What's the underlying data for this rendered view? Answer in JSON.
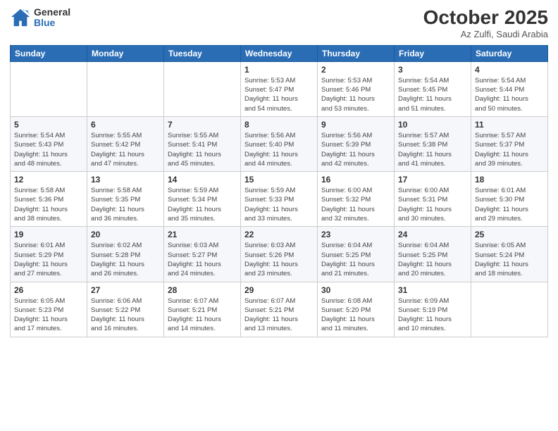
{
  "header": {
    "logo_general": "General",
    "logo_blue": "Blue",
    "month_title": "October 2025",
    "subtitle": "Az Zulfi, Saudi Arabia"
  },
  "weekdays": [
    "Sunday",
    "Monday",
    "Tuesday",
    "Wednesday",
    "Thursday",
    "Friday",
    "Saturday"
  ],
  "weeks": [
    [
      {
        "day": "",
        "detail": ""
      },
      {
        "day": "",
        "detail": ""
      },
      {
        "day": "",
        "detail": ""
      },
      {
        "day": "1",
        "detail": "Sunrise: 5:53 AM\nSunset: 5:47 PM\nDaylight: 11 hours\nand 54 minutes."
      },
      {
        "day": "2",
        "detail": "Sunrise: 5:53 AM\nSunset: 5:46 PM\nDaylight: 11 hours\nand 53 minutes."
      },
      {
        "day": "3",
        "detail": "Sunrise: 5:54 AM\nSunset: 5:45 PM\nDaylight: 11 hours\nand 51 minutes."
      },
      {
        "day": "4",
        "detail": "Sunrise: 5:54 AM\nSunset: 5:44 PM\nDaylight: 11 hours\nand 50 minutes."
      }
    ],
    [
      {
        "day": "5",
        "detail": "Sunrise: 5:54 AM\nSunset: 5:43 PM\nDaylight: 11 hours\nand 48 minutes."
      },
      {
        "day": "6",
        "detail": "Sunrise: 5:55 AM\nSunset: 5:42 PM\nDaylight: 11 hours\nand 47 minutes."
      },
      {
        "day": "7",
        "detail": "Sunrise: 5:55 AM\nSunset: 5:41 PM\nDaylight: 11 hours\nand 45 minutes."
      },
      {
        "day": "8",
        "detail": "Sunrise: 5:56 AM\nSunset: 5:40 PM\nDaylight: 11 hours\nand 44 minutes."
      },
      {
        "day": "9",
        "detail": "Sunrise: 5:56 AM\nSunset: 5:39 PM\nDaylight: 11 hours\nand 42 minutes."
      },
      {
        "day": "10",
        "detail": "Sunrise: 5:57 AM\nSunset: 5:38 PM\nDaylight: 11 hours\nand 41 minutes."
      },
      {
        "day": "11",
        "detail": "Sunrise: 5:57 AM\nSunset: 5:37 PM\nDaylight: 11 hours\nand 39 minutes."
      }
    ],
    [
      {
        "day": "12",
        "detail": "Sunrise: 5:58 AM\nSunset: 5:36 PM\nDaylight: 11 hours\nand 38 minutes."
      },
      {
        "day": "13",
        "detail": "Sunrise: 5:58 AM\nSunset: 5:35 PM\nDaylight: 11 hours\nand 36 minutes."
      },
      {
        "day": "14",
        "detail": "Sunrise: 5:59 AM\nSunset: 5:34 PM\nDaylight: 11 hours\nand 35 minutes."
      },
      {
        "day": "15",
        "detail": "Sunrise: 5:59 AM\nSunset: 5:33 PM\nDaylight: 11 hours\nand 33 minutes."
      },
      {
        "day": "16",
        "detail": "Sunrise: 6:00 AM\nSunset: 5:32 PM\nDaylight: 11 hours\nand 32 minutes."
      },
      {
        "day": "17",
        "detail": "Sunrise: 6:00 AM\nSunset: 5:31 PM\nDaylight: 11 hours\nand 30 minutes."
      },
      {
        "day": "18",
        "detail": "Sunrise: 6:01 AM\nSunset: 5:30 PM\nDaylight: 11 hours\nand 29 minutes."
      }
    ],
    [
      {
        "day": "19",
        "detail": "Sunrise: 6:01 AM\nSunset: 5:29 PM\nDaylight: 11 hours\nand 27 minutes."
      },
      {
        "day": "20",
        "detail": "Sunrise: 6:02 AM\nSunset: 5:28 PM\nDaylight: 11 hours\nand 26 minutes."
      },
      {
        "day": "21",
        "detail": "Sunrise: 6:03 AM\nSunset: 5:27 PM\nDaylight: 11 hours\nand 24 minutes."
      },
      {
        "day": "22",
        "detail": "Sunrise: 6:03 AM\nSunset: 5:26 PM\nDaylight: 11 hours\nand 23 minutes."
      },
      {
        "day": "23",
        "detail": "Sunrise: 6:04 AM\nSunset: 5:25 PM\nDaylight: 11 hours\nand 21 minutes."
      },
      {
        "day": "24",
        "detail": "Sunrise: 6:04 AM\nSunset: 5:25 PM\nDaylight: 11 hours\nand 20 minutes."
      },
      {
        "day": "25",
        "detail": "Sunrise: 6:05 AM\nSunset: 5:24 PM\nDaylight: 11 hours\nand 18 minutes."
      }
    ],
    [
      {
        "day": "26",
        "detail": "Sunrise: 6:05 AM\nSunset: 5:23 PM\nDaylight: 11 hours\nand 17 minutes."
      },
      {
        "day": "27",
        "detail": "Sunrise: 6:06 AM\nSunset: 5:22 PM\nDaylight: 11 hours\nand 16 minutes."
      },
      {
        "day": "28",
        "detail": "Sunrise: 6:07 AM\nSunset: 5:21 PM\nDaylight: 11 hours\nand 14 minutes."
      },
      {
        "day": "29",
        "detail": "Sunrise: 6:07 AM\nSunset: 5:21 PM\nDaylight: 11 hours\nand 13 minutes."
      },
      {
        "day": "30",
        "detail": "Sunrise: 6:08 AM\nSunset: 5:20 PM\nDaylight: 11 hours\nand 11 minutes."
      },
      {
        "day": "31",
        "detail": "Sunrise: 6:09 AM\nSunset: 5:19 PM\nDaylight: 11 hours\nand 10 minutes."
      },
      {
        "day": "",
        "detail": ""
      }
    ]
  ]
}
